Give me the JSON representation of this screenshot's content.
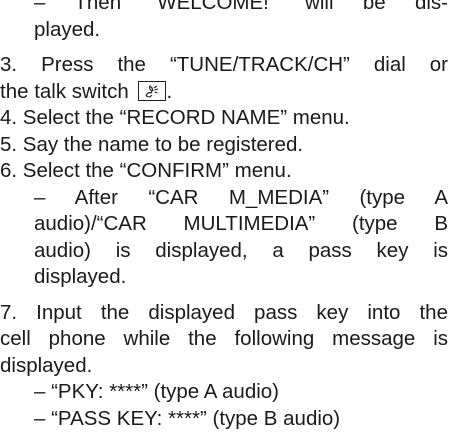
{
  "lines": {
    "welcome_l1": "– Then “WELCOME!” will be dis-",
    "welcome_l2": "played.",
    "step3_l1": "3. Press the “TUNE/TRACK/CH” dial or",
    "step3_l2": "the talk switch",
    "step3_end": ".",
    "step4": "4. Select the “RECORD NAME” menu.",
    "step5": "5. Say the name to be registered.",
    "step6": "6. Select the “CONFIRM” menu.",
    "step6_sub_l1": "– After “CAR M_MEDIA” (type A",
    "step6_sub_l2": "audio)/“CAR MULTIMEDIA” (type B",
    "step6_sub_l3": "audio) is displayed, a pass key is",
    "step6_sub_l4": "displayed.",
    "step7_l1": "7. Input the displayed pass key into the",
    "step7_l2": "cell phone while the following message is",
    "step7_l3": "displayed.",
    "msg_a": "– “PKY: ****” (type A audio)",
    "msg_b": "– “PASS KEY: ****” (type B audio)"
  },
  "icons": {
    "talk_switch": "talk-switch-icon"
  }
}
